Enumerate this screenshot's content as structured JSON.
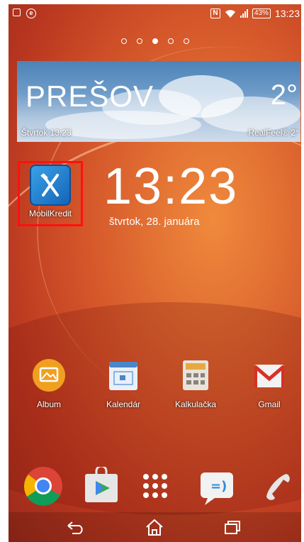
{
  "status_bar": {
    "time": "13:23",
    "battery": "43%",
    "notif_circle_letter": "e"
  },
  "pages": {
    "count": 5,
    "active_index": 2
  },
  "weather": {
    "city": "PREŠOV",
    "temperature": "2°",
    "day_time": "Štvrtok 13:23",
    "real_feel": "RealFeel® 2°"
  },
  "clock": {
    "time": "13:23",
    "date": "štvrtok, 28. januára"
  },
  "shortcut": {
    "label": "MobilKredit"
  },
  "apps": [
    {
      "label": "Album"
    },
    {
      "label": "Kalendár"
    },
    {
      "label": "Kalkulačka"
    },
    {
      "label": "Gmail"
    }
  ],
  "dock": [
    "chrome-icon",
    "play-store-icon",
    "app-drawer-icon",
    "messaging-icon",
    "phone-icon"
  ],
  "colors": {
    "highlight": "#ff1010",
    "wallpaper": "#d4562a"
  }
}
